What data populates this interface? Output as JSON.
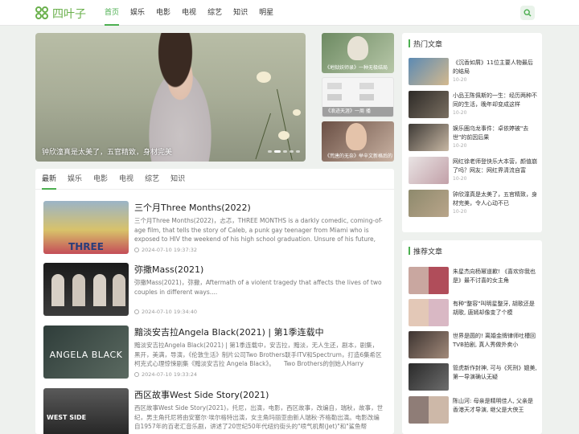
{
  "header": {
    "logo_text": "四叶子",
    "nav": [
      "首页",
      "娱乐",
      "电影",
      "电视",
      "综艺",
      "知识",
      "明星"
    ],
    "active_index": 0
  },
  "hero": {
    "caption": "钟欣潼真是太美了，五官精致，身材完美",
    "dots": 5,
    "active_dot": 1
  },
  "side_thumbs": [
    {
      "caption": "《地狱妖师录》一种无极结局"
    },
    {
      "caption": "《浪迹天涯》一周 播"
    },
    {
      "caption": "《荒唐的无奈》举辛文新格后的"
    }
  ],
  "tabs": [
    "最新",
    "娱乐",
    "电影",
    "电视",
    "综艺",
    "知识"
  ],
  "articles": [
    {
      "title": "三个月Three Months(2022)",
      "desc": "三个月Three Months(2022)，忐忑，THREE MONTHS is a darkly comedic, coming-of-age film, that tells the story of Caleb, a punk gay teenager from Miami who is exposed to HIV the weekend of his high school graduation. Unsure of his future, he sta...",
      "time": "2024-07-10 19:37:32",
      "thumb_text": "THREE"
    },
    {
      "title": "弥撒Mass(2021)",
      "desc": "弥撒Mass(2021)，弥撒，Aftermath of a violent tragedy that affects the lives of two couples in different ways....",
      "time": "2024-07-10 19:34:40",
      "thumb_text": ""
    },
    {
      "title": "黯淡安吉拉Angela Black(2021) | 第1季连载中",
      "desc": "黯淡安吉拉Angela Black(2021) | 第1季连载中，安吉拉，黯淡，无人生还，剧本，剧集，黑开，美满，导演，《伦敦生活》制片公司Two Brothers联手ITV和Spectrum，打造6集希区柯克式心理惊悚剧集《黯淡安吉拉 Angela Black》。　　Two Brothers的创始人Harry Williams和Jack Williams负责剧...",
      "time": "2024-07-10 19:33:24",
      "thumb_text": "ANGELA BLACK"
    },
    {
      "title": "西区故事West Side Story(2021)",
      "desc": "西区故事West Side Story(2021)，托尼，出演，电影，西区故事，改编自，瑞秋，故事，世纪，男主角托尼将由安塞尔·埃尔格特出演，女主角玛丽亚由新人瑞秋·齐格勒出演。电影改编自1957年的百老汇音乐剧，讲述了20世纪50年代纽约街头的\"喷气机帮(Jet)\"和\"鲨鱼帮(Sharks)\"之间的争斗，以及少...",
      "time": "",
      "thumb_text": "WEST SIDE"
    }
  ],
  "hot": {
    "title": "热门文章",
    "items": [
      {
        "title": "《沉香如屑》11位主要人物最后的结局",
        "date": "10-20"
      },
      {
        "title": "小品王陈佩斯的一生：经历两种不同的生活，晚年却变成这样",
        "date": "10-20"
      },
      {
        "title": "娱乐圈乌龙事件：卓依婷被\"去世\"的前因后果",
        "date": "10-20"
      },
      {
        "title": "网红徐老师登快乐大本营，颜值崩了吗？网友：网红界清流自富",
        "date": "10-20"
      },
      {
        "title": "钟欣潼真是太美了，五官精致，身材完美，令人心动不已",
        "date": "10-20"
      }
    ]
  },
  "recommend": {
    "title": "推荐文章",
    "items": [
      {
        "title": "朱星杰向杨幂道歉! 《喜欢你我也是》最不讨喜的女主角"
      },
      {
        "title": "有种\"整容\"叫明星整牙, 胡歌还是胡歌, 唐嫣却像变了个模"
      },
      {
        "title": "世界是圆的! 离婚金牌律师吐槽回TVB拍剧, 真人秀做外卖小"
      },
      {
        "title": "管虎新作封神, 可与《死刑》媲美, 第一导演确认无疑"
      },
      {
        "title": "陈山河: 母亲是精明佳人, 父亲是香港天才导演, 继父是大侠王"
      }
    ]
  }
}
